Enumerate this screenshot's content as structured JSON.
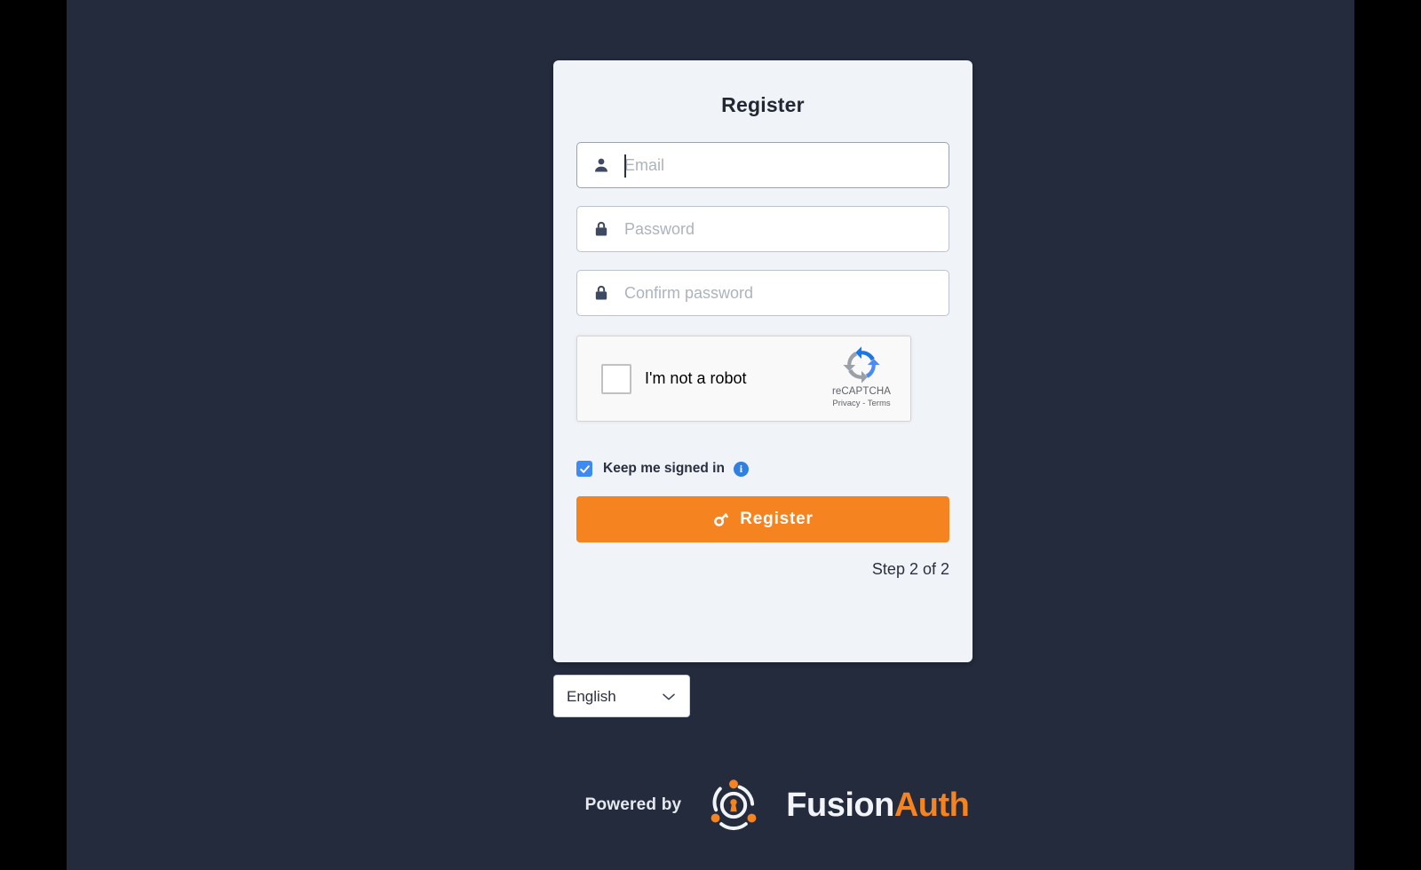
{
  "theme": {
    "page_background": "#242B3D",
    "card_background": "#F0F3F8",
    "accent_orange": "#F58320",
    "accent_blue": "#3D8BF2",
    "text_dark": "#2B3040"
  },
  "card": {
    "title": "Register",
    "fields": [
      {
        "name": "email",
        "icon": "user-icon",
        "placeholder": "Email",
        "value": "",
        "type": "text",
        "focused": true
      },
      {
        "name": "password",
        "icon": "lock-icon",
        "placeholder": "Password",
        "value": "",
        "type": "password",
        "focused": false
      },
      {
        "name": "confirm_password",
        "icon": "lock-icon",
        "placeholder": "Confirm password",
        "value": "",
        "type": "password",
        "focused": false
      }
    ],
    "recaptcha": {
      "label": "I'm not a robot",
      "checked": false,
      "brand": "reCAPTCHA",
      "links": "Privacy - Terms"
    },
    "keep_signed_in": {
      "label": "Keep me signed in",
      "checked": true,
      "info_glyph": "i"
    },
    "submit": {
      "label": "Register",
      "icon": "key-icon"
    },
    "step_text": "Step 2 of 2"
  },
  "language": {
    "selected": "English",
    "options": [
      "English"
    ],
    "chevron": "chevron-down-icon"
  },
  "footer": {
    "powered_by": "Powered by",
    "brand_part1": "Fusion",
    "brand_part2": "Auth",
    "logo": "fusionauth-logo-icon"
  }
}
